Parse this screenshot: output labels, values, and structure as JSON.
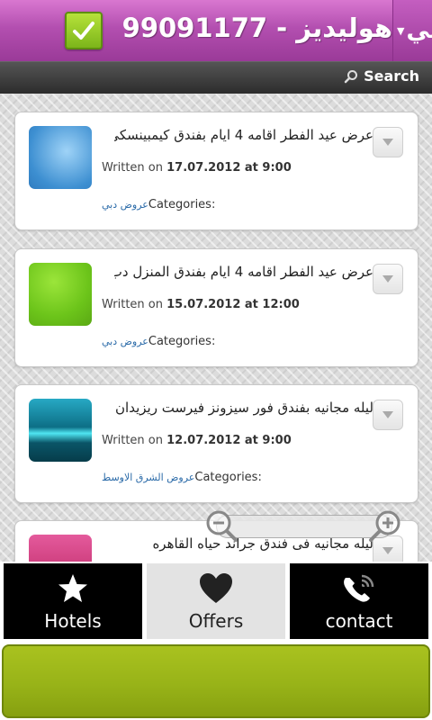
{
  "header": {
    "title": "99091177 - هوليديز",
    "right_fragment": "مي",
    "check_icon": "checkmark-icon"
  },
  "search": {
    "label": "Search"
  },
  "posts": [
    {
      "title": "عرض عيد الفطر اقامه 4 ايام بفندق كيمبينسكي...",
      "written_prefix": "Written on",
      "date": "17.07.2012 at 9:00",
      "categories_label": "Categories:",
      "category": "عروض دبي",
      "thumb_color": "#5aa7e0"
    },
    {
      "title": "عرض عيد الفطر اقامه 4 ايام بفندق المنزل دب...",
      "written_prefix": "Written on",
      "date": "15.07.2012 at 12:00",
      "categories_label": "Categories:",
      "category": "عروض دبي",
      "thumb_color": "#72cf1c"
    },
    {
      "title": "ليله مجانيه بفندق فور سيزونز فيرست ريزيدان...",
      "written_prefix": "Written on",
      "date": "12.07.2012 at 9:00",
      "categories_label": "Categories:",
      "category": "عروض الشرق الاوسط",
      "thumb_color": "#1e8fa8"
    },
    {
      "title": "ليله مجانيه فى فندق جراند حياه القاهره",
      "thumb_color": "#c2306e"
    }
  ],
  "tabs": [
    {
      "label": "Hotels",
      "icon": "star-icon",
      "active": false
    },
    {
      "label": "Offers",
      "icon": "heart-icon",
      "active": true
    },
    {
      "label": "contact",
      "icon": "phone-icon",
      "active": false
    }
  ],
  "colors": {
    "header_purple": "#b34fb0",
    "accent_green": "#98b318",
    "link_blue": "#2a6aa8"
  }
}
